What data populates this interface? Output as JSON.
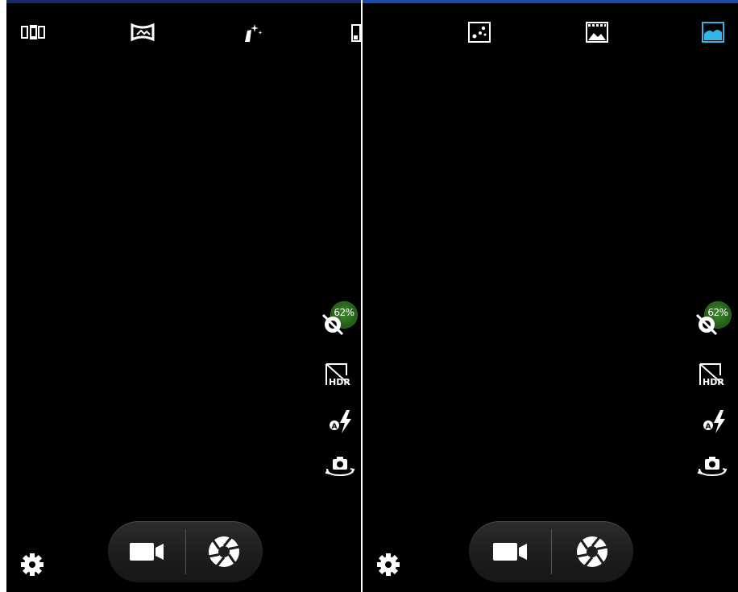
{
  "colors": {
    "background": "#000000",
    "icon": "#ffffff",
    "accent_selected": "#33b5e5",
    "battery_green": "#2f6e20"
  },
  "screens": [
    {
      "top_modes": [
        {
          "name": "burst-shot-icon",
          "selected": false
        },
        {
          "name": "panorama-icon",
          "selected": false
        },
        {
          "name": "beautify-wand-icon",
          "selected": false
        },
        {
          "name": "smart-scene-icon",
          "selected": false
        }
      ],
      "battery": {
        "percent_label": "62%"
      },
      "side_controls": [
        {
          "name": "timer-off-icon"
        },
        {
          "name": "hdr-icon",
          "label": "HDR"
        },
        {
          "name": "flash-auto-icon",
          "label": "A"
        },
        {
          "name": "switch-camera-icon"
        }
      ],
      "shutter_bar": [
        "video-record",
        "photo-shutter"
      ],
      "settings": "gear-icon"
    },
    {
      "top_modes": [
        {
          "name": "night-scene-icon",
          "selected": false
        },
        {
          "name": "film-scene-icon",
          "selected": false
        },
        {
          "name": "landscape-scene-icon",
          "selected": true
        }
      ],
      "battery": {
        "percent_label": "62%"
      },
      "side_controls": [
        {
          "name": "timer-off-icon"
        },
        {
          "name": "hdr-icon",
          "label": "HDR"
        },
        {
          "name": "flash-auto-icon",
          "label": "A"
        },
        {
          "name": "switch-camera-icon"
        }
      ],
      "shutter_bar": [
        "video-record",
        "photo-shutter"
      ],
      "settings": "gear-icon"
    }
  ]
}
